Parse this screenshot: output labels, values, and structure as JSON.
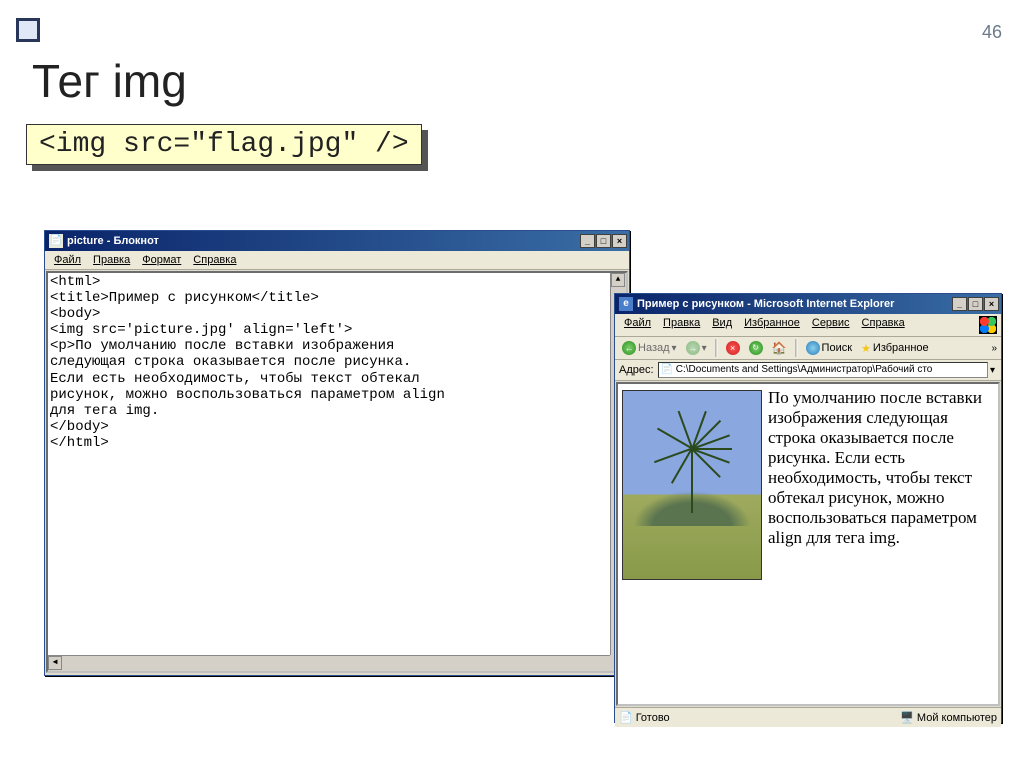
{
  "page_number": "46",
  "slide_title": "Тег img",
  "code_box": "<img src=\"flag.jpg\" />",
  "notepad": {
    "title": "picture - Блокнот",
    "menu": {
      "file": "Файл",
      "edit": "Правка",
      "format": "Формат",
      "help": "Справка"
    },
    "code_lines": [
      "<html>",
      "<title>Пример с рисунком</title>",
      "<body>",
      "<img src='picture.jpg' align='left'>",
      "<p>По умолчанию после вставки изображения",
      "следующая строка оказывается после рисунка.",
      "Если есть необходимость, чтобы текст обтекал",
      "рисунок, можно воспользоваться параметром align",
      "для тега img.",
      "</body>",
      "</html>"
    ]
  },
  "ie": {
    "title": "Пример с рисунком - Microsoft Internet Explorer",
    "menu": {
      "file": "Файл",
      "edit": "Правка",
      "view": "Вид",
      "favorites": "Избранное",
      "tools": "Сервис",
      "help": "Справка"
    },
    "toolbar": {
      "back": "Назад",
      "search": "Поиск",
      "favorites": "Избранное"
    },
    "address": {
      "label": "Адрес:",
      "value": "C:\\Documents and Settings\\Администратор\\Рабочий сто"
    },
    "body_text": "По умолчанию после вставки изображения следующая строка оказывается после рисунка. Если есть необходимость, чтобы текст обтекал рисунок, можно воспользоваться параметром align для тега img.",
    "status": {
      "done": "Готово",
      "zone": "Мой компьютер"
    }
  },
  "window_btns": {
    "min": "_",
    "max": "□",
    "close": "×"
  }
}
